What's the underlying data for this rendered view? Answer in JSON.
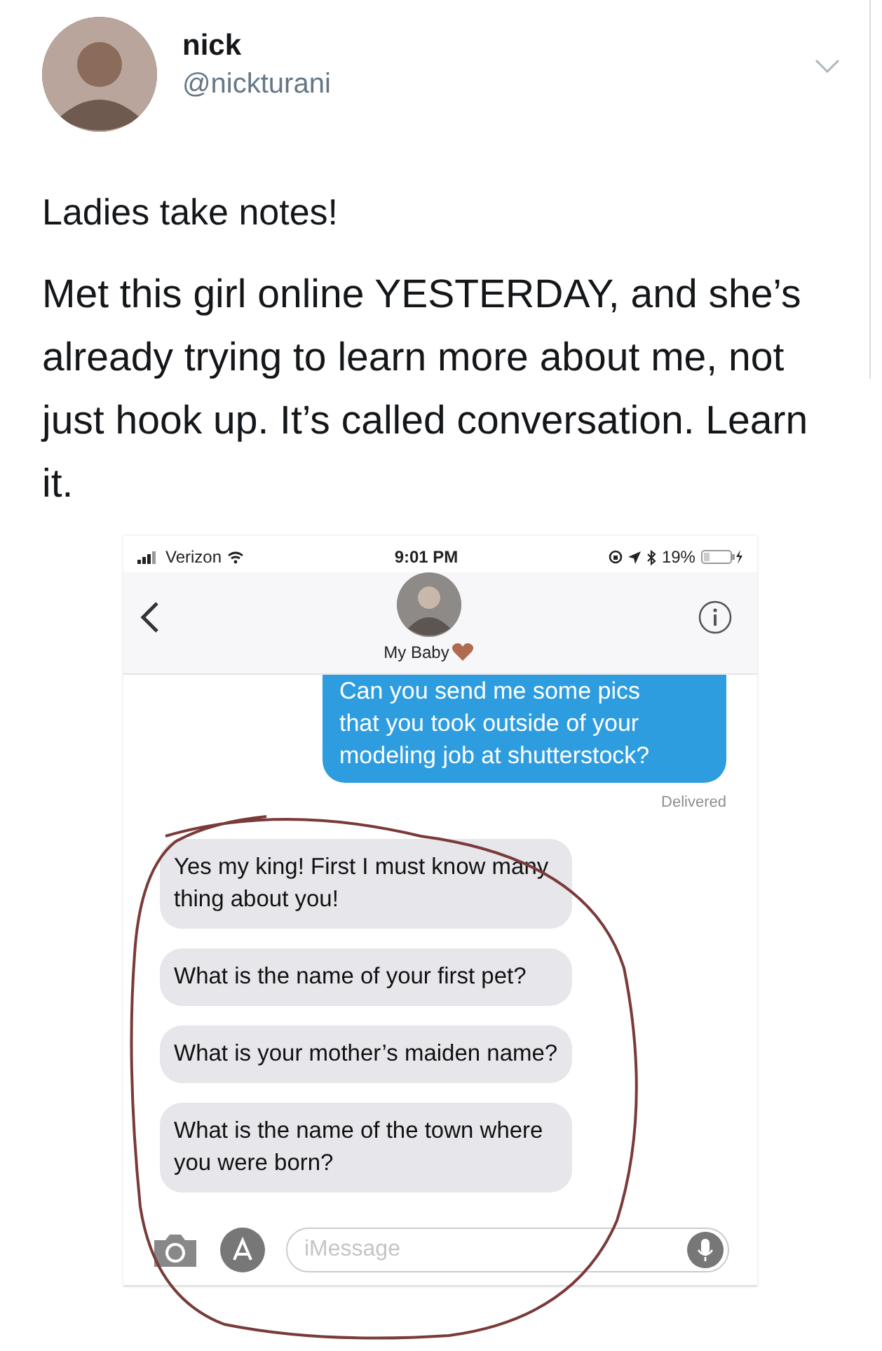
{
  "tweet": {
    "author": {
      "name": "nick",
      "handle": "@nickturani"
    },
    "lines": [
      "Ladies take notes!",
      "Met this girl online YESTERDAY, and she’s already trying to learn more about me, not just hook up. It’s called conversation. Learn it."
    ]
  },
  "phone": {
    "status_bar": {
      "carrier": "Verizon",
      "time": "9:01 PM",
      "battery": "19%"
    },
    "contact": {
      "name": "My Baby"
    },
    "messages": [
      {
        "kind": "sent",
        "cut_line": "Can you send me some pics",
        "text": "that you took outside of your modeling job at shutterstock?"
      },
      {
        "kind": "status",
        "text": "Delivered"
      },
      {
        "kind": "received",
        "text": "Yes my king! First I must know many thing about you!"
      },
      {
        "kind": "received",
        "text": "What is the name of your first pet?"
      },
      {
        "kind": "received",
        "text": "What is your mother’s maiden name?"
      },
      {
        "kind": "received",
        "text": "What is the name of the town where you were born?"
      }
    ],
    "input": {
      "placeholder": "iMessage"
    }
  }
}
